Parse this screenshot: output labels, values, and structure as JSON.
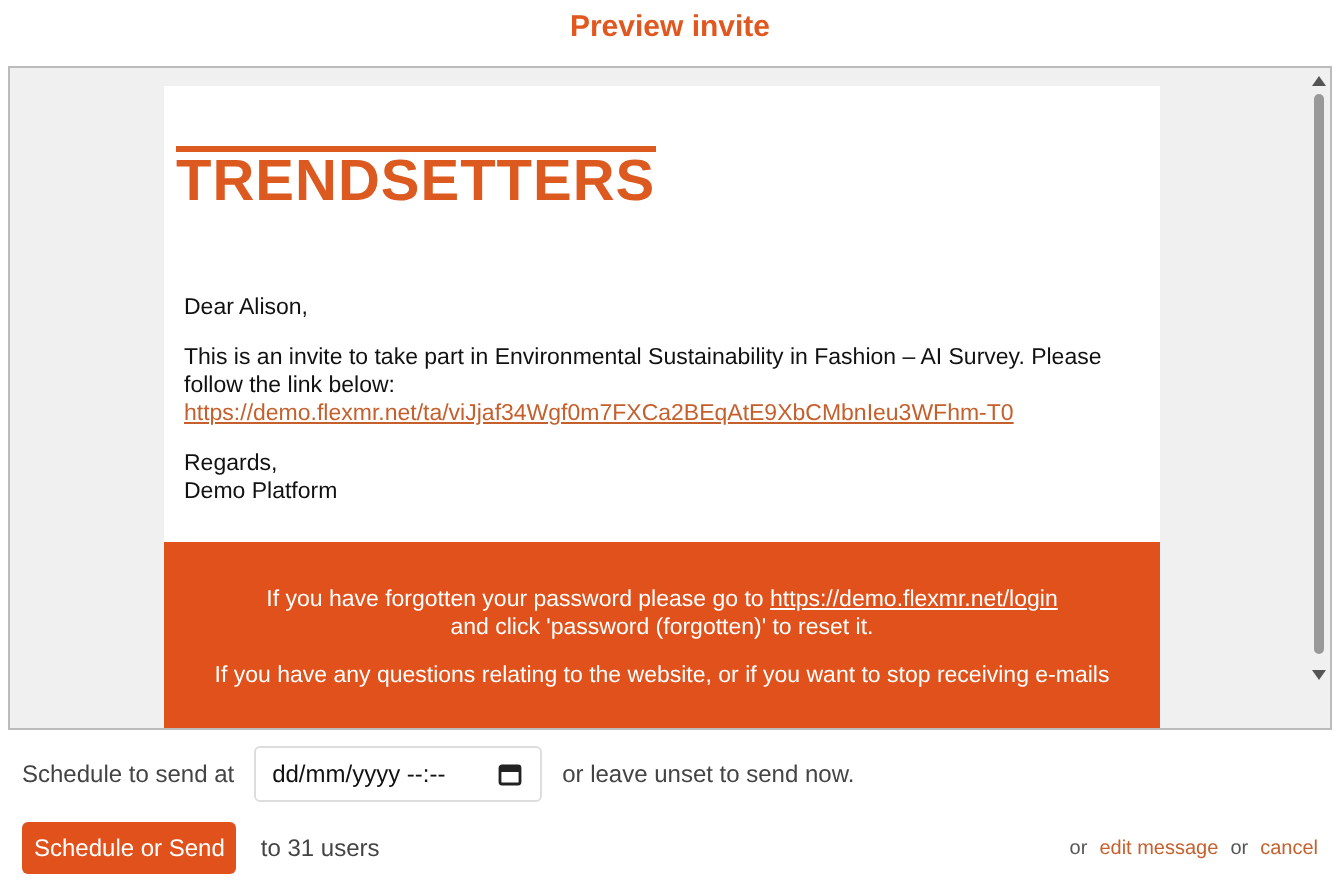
{
  "title": "Preview invite",
  "email": {
    "logo": "TRENDSETTERS",
    "greeting": "Dear Alison,",
    "body": "This is an invite to take part in Environmental Sustainability in Fashion – AI Survey. Please follow the link below:",
    "link": "https://demo.flexmr.net/ta/viJjaf34Wgf0m7FXCa2BEqAtE9XbCMbnIeu3WFhm-T0",
    "signoff": "Regards,",
    "sender": "Demo Platform",
    "footer": {
      "password_text": "If you have forgotten your password please go to",
      "password_link": "https://demo.flexmr.net/login",
      "password_text_2": "and click 'password (forgotten)' to reset it.",
      "questions_text": "If you have any questions relating to the website, or if you want to stop receiving e-mails"
    }
  },
  "schedule": {
    "label": "Schedule to send at",
    "placeholder": "dd/mm/yyyy --:--",
    "hint": "or leave unset to send now."
  },
  "actions": {
    "send_button": "Schedule or Send",
    "recipients": "to 31 users",
    "or_1": "or",
    "edit_link": "edit message",
    "or_2": "or",
    "cancel_link": "cancel"
  }
}
